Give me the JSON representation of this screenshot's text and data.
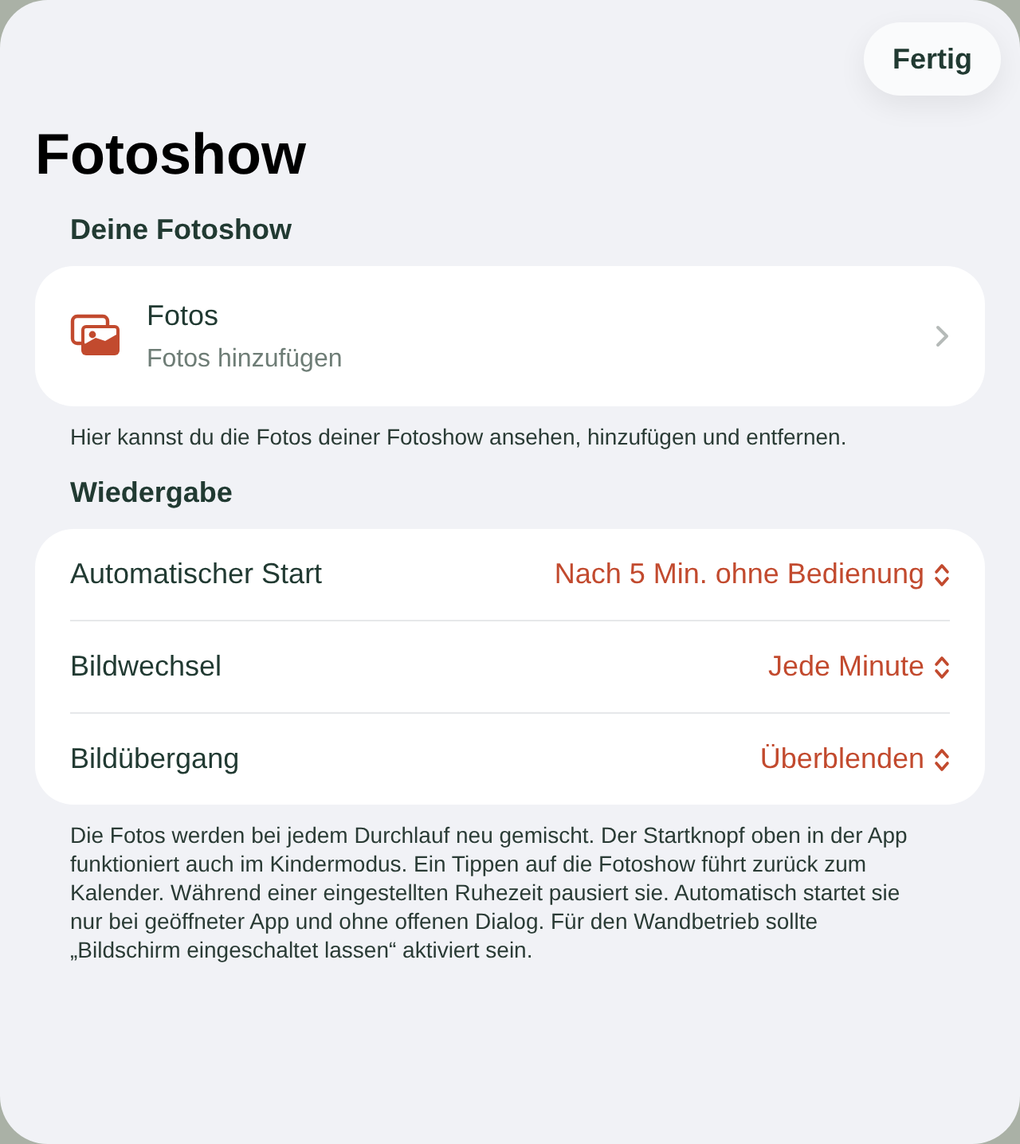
{
  "done_button": "Fertig",
  "title": "Fotoshow",
  "photos_section": {
    "header": "Deine Fotoshow",
    "item": {
      "title": "Fotos",
      "subtitle": "Fotos hinzufügen"
    },
    "footer": "Hier kannst du die Fotos deiner Fotoshow ansehen, hinzufügen und entfernen."
  },
  "playback_section": {
    "header": "Wiedergabe",
    "rows": [
      {
        "label": "Automatischer Start",
        "value": "Nach 5 Min. ohne Bedienung"
      },
      {
        "label": "Bildwechsel",
        "value": "Jede Minute"
      },
      {
        "label": "Bildübergang",
        "value": "Überblenden"
      }
    ],
    "footer": "Die Fotos werden bei jedem Durchlauf neu gemischt. Der Startknopf oben in der App funktioniert auch im Kindermodus. Ein Tippen auf die Fotoshow führt zurück zum Kalender. Während einer eingestellten Ruhezeit pausiert sie. Automatisch startet sie nur bei geöffneter App und ohne offenen Dialog. Für den Wandbetrieb sollte „Bildschirm eingeschaltet lassen“ aktiviert sein."
  }
}
